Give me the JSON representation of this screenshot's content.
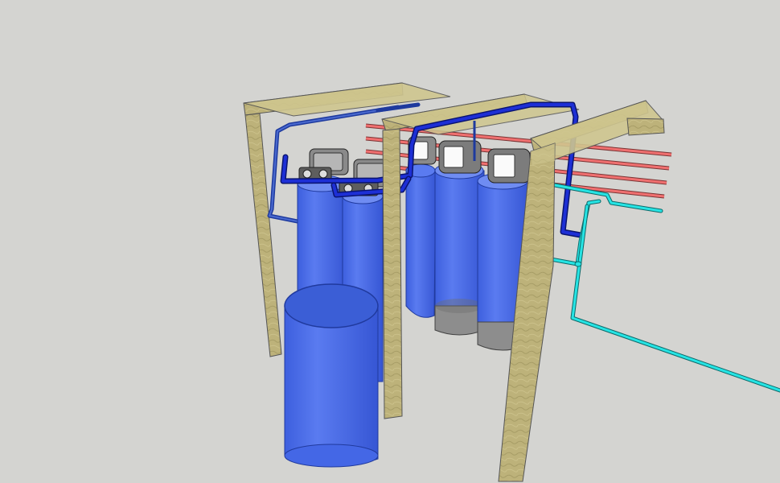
{
  "scene": {
    "colors": {
      "background": "#d4d4d1",
      "wood": "#b7ad76",
      "wood_dark": "#8c8455",
      "wood_light": "#cfc68f",
      "tank": "#4b6de8",
      "tank_dark": "#2f4fc8",
      "tank_light": "#6f8cf2",
      "brine_tank": "#4467e6",
      "pipe_blue": "#1d2fd6",
      "pipe_outline": "#0a1470",
      "pipe_red": "#f07070",
      "pipe_cyan": "#26e4e4",
      "valve_gray": "#8a8a8a",
      "tank_base": "#8d8d8d"
    },
    "objects": [
      {
        "name": "wooden-frame",
        "count": 3
      },
      {
        "name": "pressure-tank",
        "count": 5
      },
      {
        "name": "control-valve",
        "count": 5
      },
      {
        "name": "brine-tank",
        "count": 1
      },
      {
        "name": "hot-water-line",
        "count": 5
      },
      {
        "name": "treated-water-line",
        "count": 2
      }
    ]
  }
}
